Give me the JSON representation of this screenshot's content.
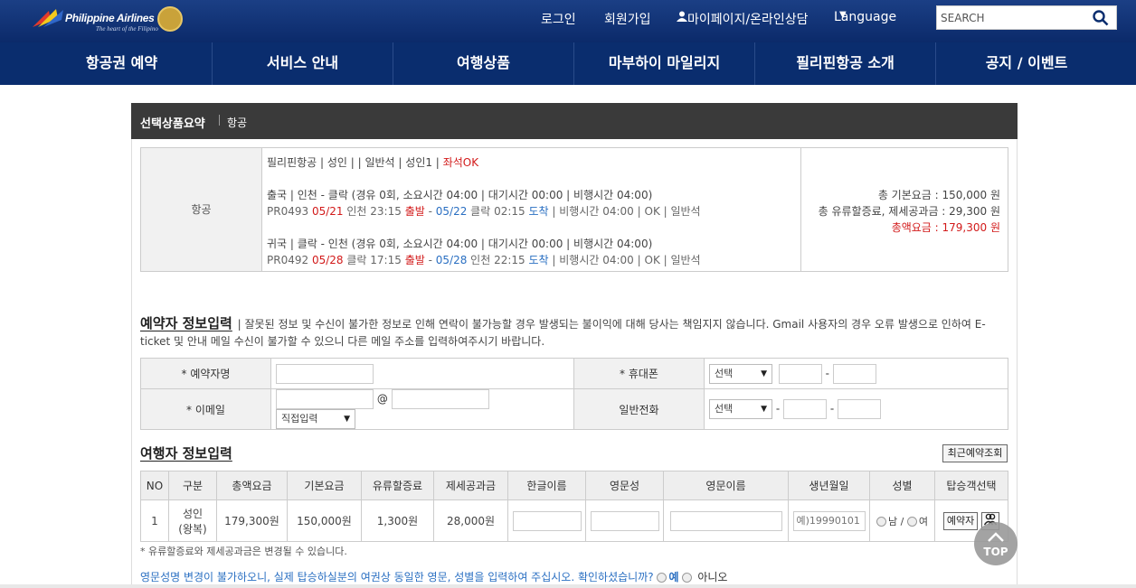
{
  "header": {
    "brand": "Philippine Airlines",
    "tagline": "The heart of the Filipino",
    "links": [
      "로그인",
      "회원가입",
      "마이페이지/온라인상담",
      "Language"
    ],
    "search_placeholder": "SEARCH"
  },
  "nav": [
    "항공권 예약",
    "서비스 안내",
    "여행상품",
    "마부하이 마일리지",
    "필리핀항공 소개",
    "공지 / 이벤트"
  ],
  "summary": {
    "title": "선택상품요약",
    "subtitle": "항공",
    "row_label": "항공",
    "line1": "필리핀항공 | 성인 | | 일반석 | 성인1 |",
    "line1_status": "좌석OK",
    "out_title": "출국 | 인천 - 클락 (경유 0회, 소요시간 04:00 | 대기시간 00:00 | 비행시간 04:00)",
    "out_a": "PR0493",
    "out_date1": "05/21",
    "out_b": "인천 23:15",
    "out_dep": "출발",
    "out_date2": "05/22",
    "out_c": "클락 02:15",
    "out_arr": "도착",
    "out_d": "| 비행시간 04:00 | OK | 일반석",
    "ret_title": "귀국 | 클락 - 인천 (경유 0회, 소요시간 04:00 | 대기시간 00:00 | 비행시간 04:00)",
    "ret_a": "PR0492",
    "ret_date1": "05/28",
    "ret_b": "클락 17:15",
    "ret_dep": "출발",
    "ret_date2": "05/28",
    "ret_c": "인천 22:15",
    "ret_arr": "도착",
    "ret_d": "| 비행시간 04:00 | OK | 일반석",
    "base_fare": "총 기본요금 : 150,000 원",
    "tax_fare": "총 유류할증료, 제세공과금 : 29,300 원",
    "total_fare": "총액요금 : 179,300 원"
  },
  "booker": {
    "title": "예약자 정보입력",
    "notice": "| 잘못된 정보 및 수신이 불가한 정보로 인해 연락이 불가능할 경우 발생되는 불이익에 대해 당사는 책임지지 않습니다. Gmail 사용자의 경우 오류 발생으로 인하여 E-ticket 및 안내 메일 수신이 불가할 수 있으니 다른 메일 주소를 입력하여주시기 바랍니다.",
    "name_label": "* 예약자명",
    "mobile_label": "* 휴대폰",
    "email_label": "* 이메일",
    "phone_label": "일반전화",
    "select_label": "선택",
    "email_domain_select": "직접입력",
    "at": "@",
    "dash": "-"
  },
  "traveler": {
    "title": "여행자 정보입력",
    "recent_button": "최근예약조회",
    "headers": [
      "NO",
      "구분",
      "총액요금",
      "기본요금",
      "유류할증료",
      "제세공과금",
      "한글이름",
      "영문성",
      "영문이름",
      "생년월일",
      "성별",
      "탑승객선택"
    ],
    "row": {
      "no": "1",
      "type": "성인",
      "type_sub": "(왕복)",
      "total": "179,300원",
      "base": "150,000원",
      "fuel": "1,300원",
      "tax": "28,000원",
      "birth_placeholder": "예)19990101",
      "male": "남 /",
      "female": "여",
      "select_button": "예약자"
    },
    "footnote": "* 유류할증료와 제세공과금은 변경될 수 있습니다.",
    "confirm_text": "영문성명 변경이 불가하오니, 실제 탑승하실분의 여권상 동일한 영문, 성별을 입력하여 주십시오. 확인하셨습니까?",
    "yes": "예",
    "no": "아니오"
  },
  "top_button": "TOP",
  "colors": {
    "navy": "#0a2d6e",
    "red": "#d21a1a",
    "blue": "#2a6fc2"
  }
}
